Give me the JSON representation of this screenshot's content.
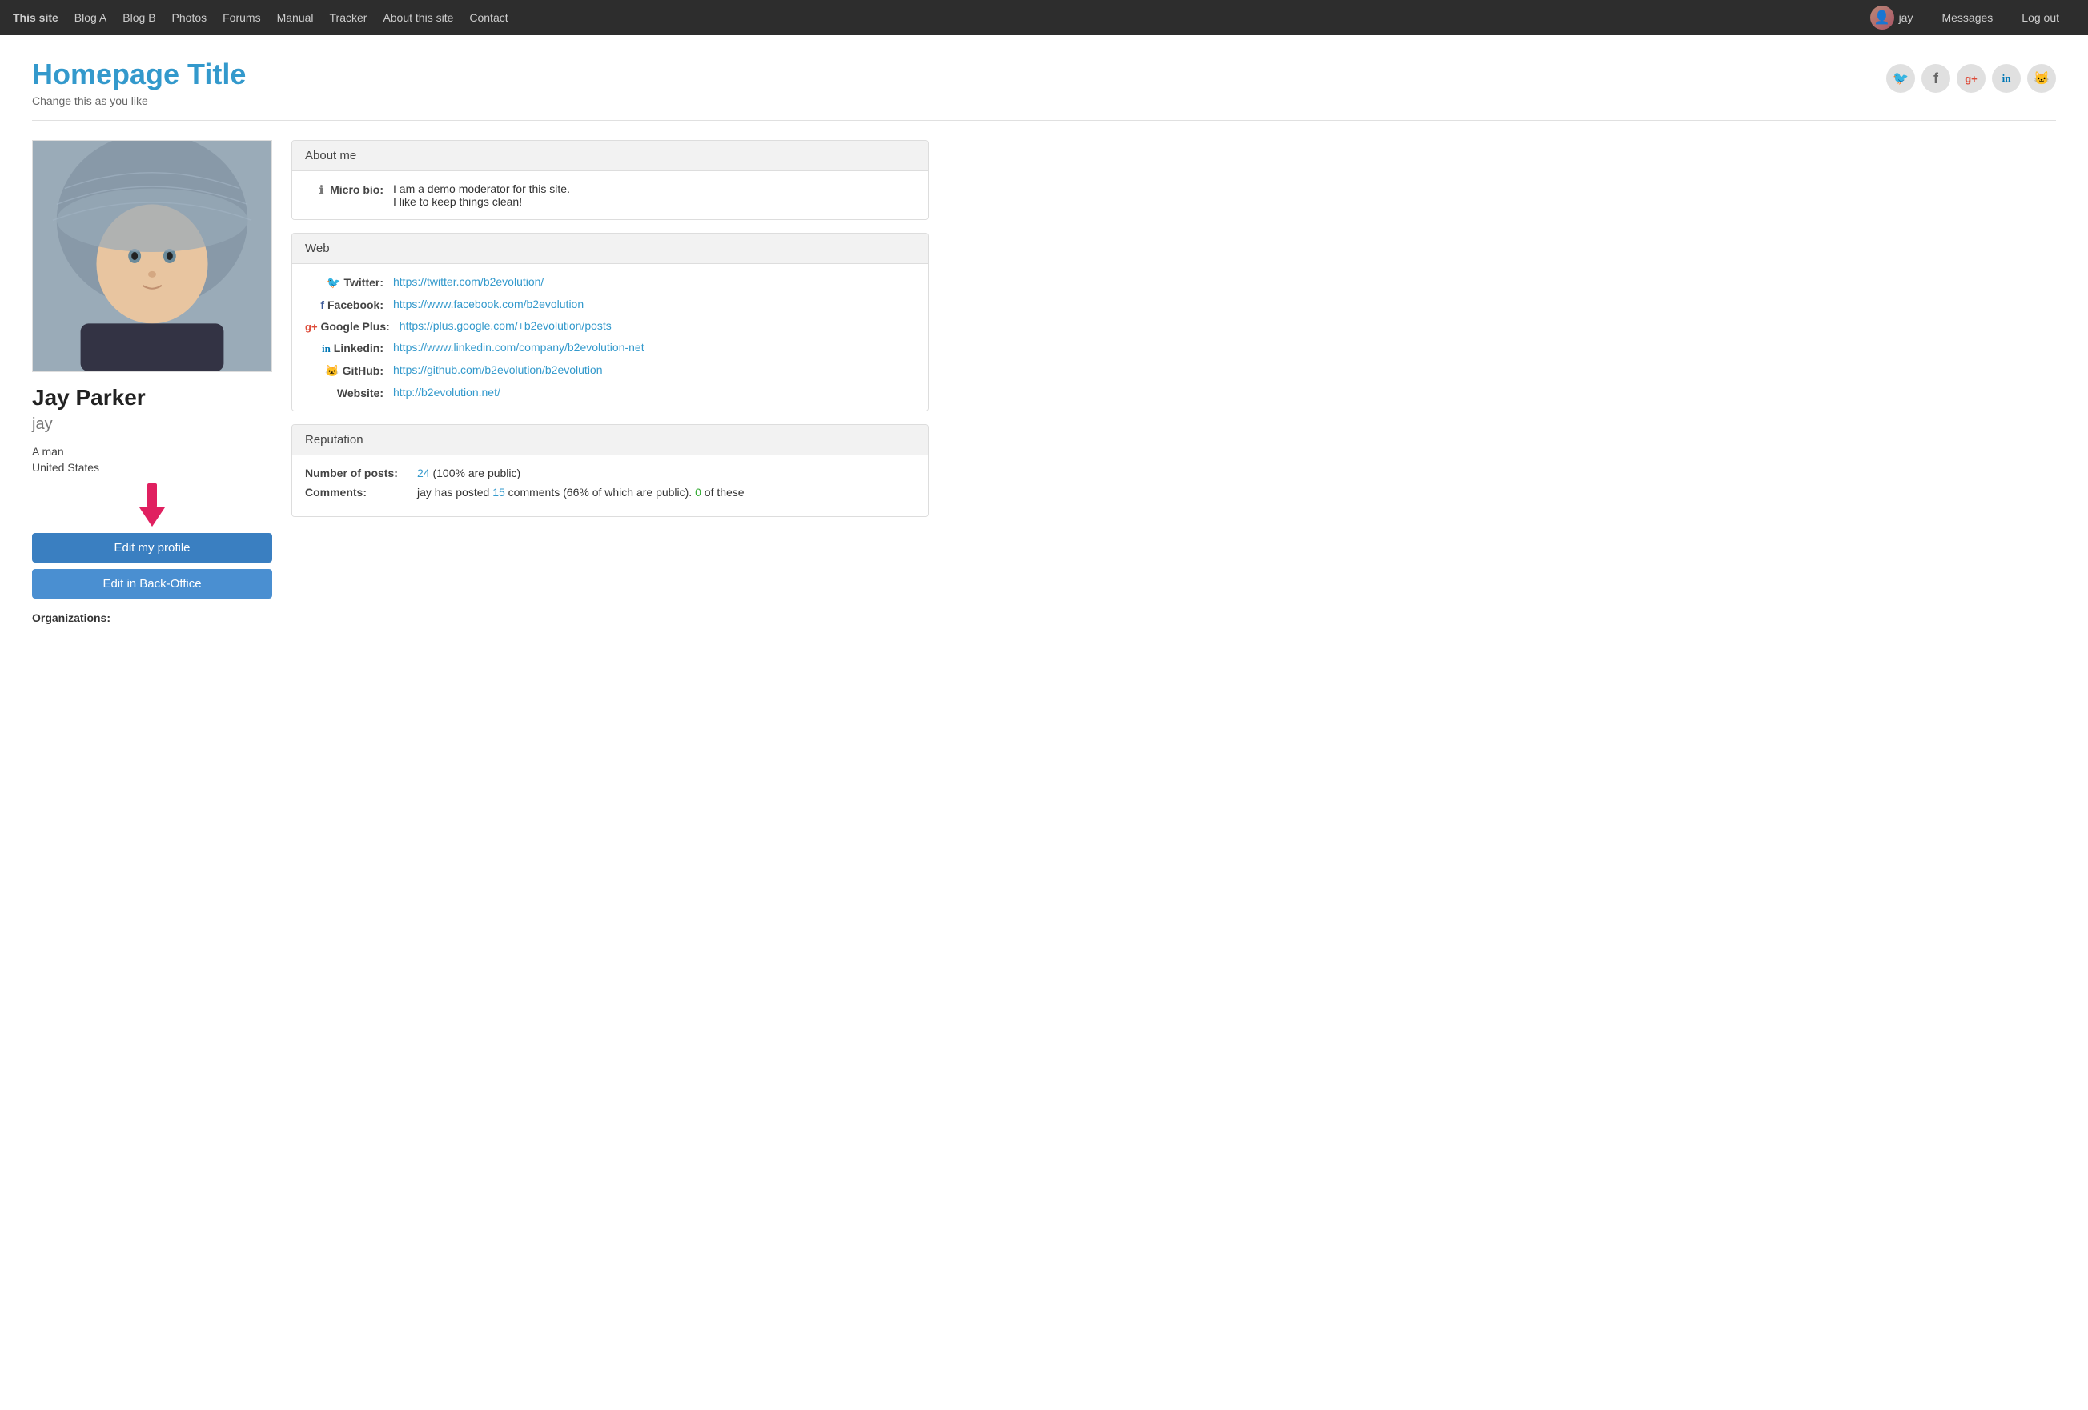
{
  "nav": {
    "brand": "This site",
    "links": [
      "Blog A",
      "Blog B",
      "Photos",
      "Forums",
      "Manual",
      "Tracker",
      "About this site",
      "Contact"
    ],
    "user": "jay",
    "messages": "Messages",
    "logout": "Log out"
  },
  "header": {
    "title": "Homepage Title",
    "subtitle": "Change this as you like"
  },
  "social_icons": [
    {
      "name": "twitter-icon",
      "symbol": "🐦"
    },
    {
      "name": "facebook-icon",
      "symbol": "f"
    },
    {
      "name": "googleplus-icon",
      "symbol": "g+"
    },
    {
      "name": "linkedin-icon",
      "symbol": "in"
    },
    {
      "name": "github-icon",
      "symbol": "🐱"
    }
  ],
  "profile": {
    "full_name": "Jay Parker",
    "username": "jay",
    "gender": "A man",
    "country": "United States",
    "edit_profile_btn": "Edit my profile",
    "edit_backoffice_btn": "Edit in Back-Office",
    "organizations_label": "Organizations:"
  },
  "about_me": {
    "section_title": "About me",
    "micro_bio_label": "Micro bio:",
    "micro_bio_line1": "I am a demo moderator for this site.",
    "micro_bio_line2": "I like to keep things clean!"
  },
  "web": {
    "section_title": "Web",
    "rows": [
      {
        "label": "Twitter:",
        "icon": "twitter",
        "url": "https://twitter.com/b2evolution/",
        "display": "https://twitter.com/b2evolution/"
      },
      {
        "label": "Facebook:",
        "icon": "facebook",
        "url": "https://www.facebook.com/b2evolution",
        "display": "https://www.facebook.com/b2evolution"
      },
      {
        "label": "Google Plus:",
        "icon": "gplus",
        "url": "https://plus.google.com/+b2evolution/posts",
        "display": "https://plus.google.com/+b2evolution/posts"
      },
      {
        "label": "Linkedin:",
        "icon": "linkedin",
        "url": "https://www.linkedin.com/company/b2evolution-net",
        "display": "https://www.linkedin.com/company/b2evolution-net"
      },
      {
        "label": "GitHub:",
        "icon": "github",
        "url": "https://github.com/b2evolution/b2evolution",
        "display": "https://github.com/b2evolution/b2evolution"
      },
      {
        "label": "Website:",
        "icon": "",
        "url": "http://b2evolution.net/",
        "display": "http://b2evolution.net/"
      }
    ]
  },
  "reputation": {
    "section_title": "Reputation",
    "num_posts_label": "Number of posts:",
    "num_posts_value": "24",
    "num_posts_suffix": "(100% are public)",
    "comments_label": "Comments:",
    "comments_text": "jay has posted",
    "comments_count": "15",
    "comments_suffix": "comments (66% of which are public).",
    "comments_green": "0",
    "comments_green_suffix": "of these"
  }
}
